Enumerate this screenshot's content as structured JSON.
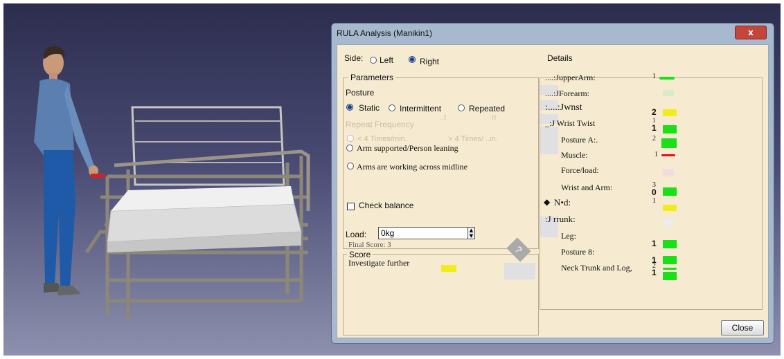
{
  "dialog": {
    "title": "RULA Analysis (Manikin1)",
    "close_x": "x",
    "side_label": "Side:",
    "side_left": "Left",
    "side_right": "Right",
    "details_label": "Details",
    "close_button": "Close"
  },
  "parameters": {
    "group_label": "Parameters",
    "posture_label": "Posture",
    "static": "Static",
    "intermittent": "Intermittent",
    "repeated": "Repeated",
    "repeat_frequency": "Repeat Frequency",
    "lt4": "< 4 Times/min.",
    "gt4": "> 4 Times/ ..in.",
    "arm_supported": "Arm supported/Person leaning",
    "arms_midline": "Arms are working across midline",
    "check_balance": "Check balance",
    "load_label": "Load:",
    "load_value": "0kg",
    "final_score": "Final Score: 3",
    "score_group": "Score",
    "investigate": "Investigate further",
    "ghost_t": "..t",
    "ghost_rr": "rr",
    "ghost_q": "?"
  },
  "details": {
    "rows": [
      {
        "label": "....:JupperArm:",
        "score": "1"
      },
      {
        "label": "....:JForearm:",
        "score": ""
      },
      {
        "label": ":....:Jwnst",
        "score": "2"
      },
      {
        "label": "_:J Wrist Twist",
        "score": "1"
      },
      {
        "label": "Posture A:.",
        "score": "2"
      },
      {
        "label": "Muscle:",
        "score": "1"
      },
      {
        "label": "Force/load:",
        "score": ""
      },
      {
        "label": "Wrist and Arm:",
        "score": "3"
      },
      {
        "label": "N•d:",
        "score": "1"
      },
      {
        "label": ":J rrunk:",
        "score": ""
      },
      {
        "label": "Leg:",
        "score": "1"
      },
      {
        "label": "Posture 8:",
        "score": "1"
      },
      {
        "label": "Neck Trunk and Log,",
        "score": "2"
      }
    ],
    "extra": {
      "wrist_twist_small": "1",
      "wrist_arm_extra": "0",
      "neck_extra": "1",
      "ned_icon": "◆"
    }
  },
  "colors": {
    "ok": "#19e019",
    "warn": "#f0ee1a",
    "bad": "#e0101a",
    "panel": "#f6ead0"
  }
}
